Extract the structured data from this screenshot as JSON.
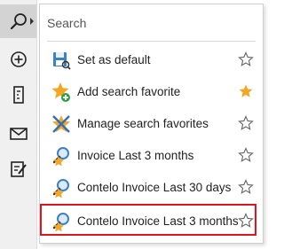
{
  "rail": {
    "buttons": [
      {
        "name": "search",
        "icon": "search-icon",
        "active": true
      },
      {
        "name": "add",
        "icon": "plus-circle-icon"
      },
      {
        "name": "document",
        "icon": "document-icon"
      },
      {
        "name": "mail",
        "icon": "envelope-icon"
      },
      {
        "name": "edit",
        "icon": "edit-note-icon"
      }
    ]
  },
  "menu": {
    "header": "Search",
    "items": [
      {
        "label": "Set as default",
        "icon": "save-search-icon",
        "favorite": false
      },
      {
        "label": "Add search favorite",
        "icon": "star-add-icon",
        "favorite": true
      },
      {
        "label": "Manage search favorites",
        "icon": "star-manage-icon",
        "favorite": false
      },
      {
        "label": "Invoice Last 3 months",
        "icon": "saved-search-icon",
        "favorite": false
      },
      {
        "label": "Contelo Invoice Last 30 days",
        "icon": "saved-search-icon",
        "favorite": false
      },
      {
        "label": "Contelo Invoice Last 3 months",
        "icon": "saved-search-icon",
        "favorite": false,
        "highlighted": true
      }
    ]
  },
  "colors": {
    "star_filled": "#f5a623",
    "star_outline": "#666666",
    "highlight": "#e0141e",
    "rail_bg": "#f0f0f0"
  }
}
